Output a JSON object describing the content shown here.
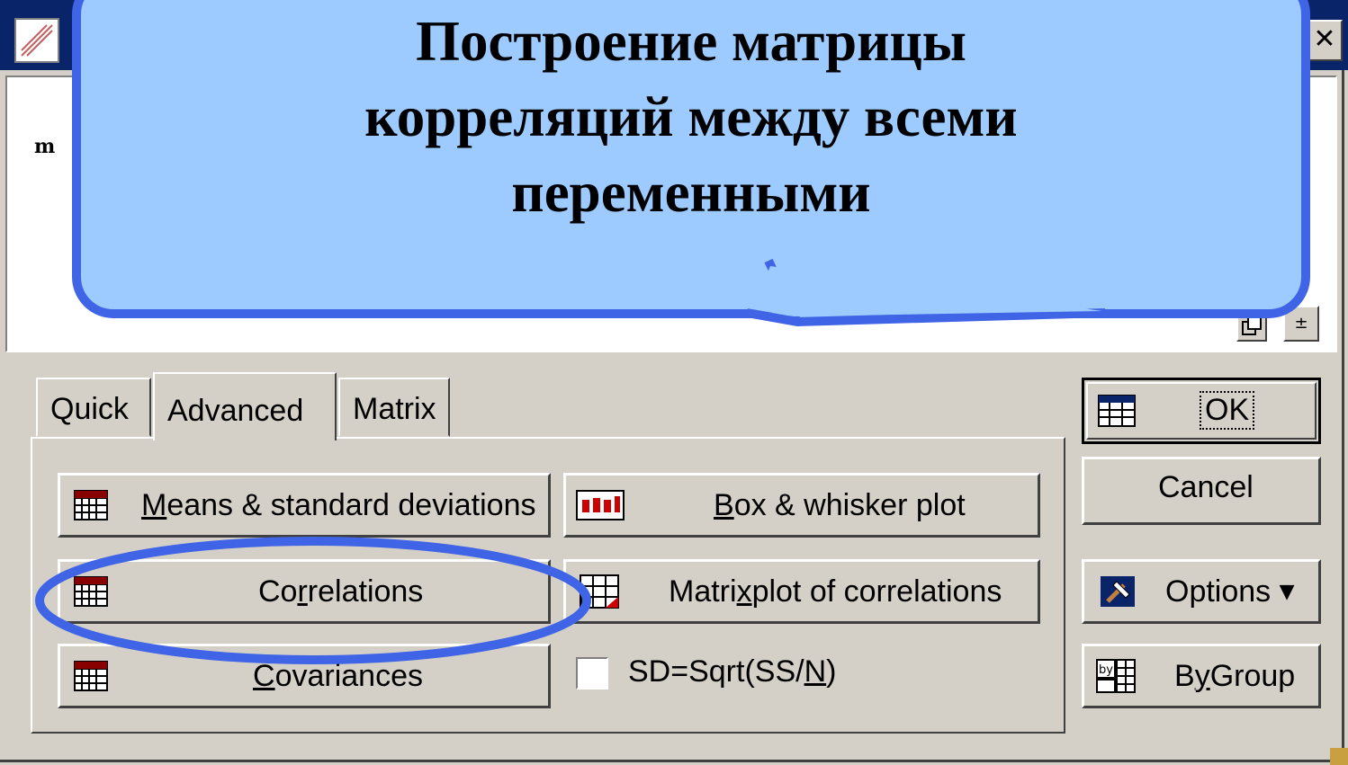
{
  "window": {
    "close_glyph": "✕",
    "results_text": "m"
  },
  "results_controls": {
    "copy_icon": "copy-icon",
    "collapse_glyph": "±"
  },
  "tabs": [
    {
      "label": "Quick",
      "active": false
    },
    {
      "label": "Advanced",
      "active": true
    },
    {
      "label": "Matrix",
      "active": false
    }
  ],
  "buttons": {
    "means_pre": "",
    "means_u": "M",
    "means_post": "eans & standard deviations",
    "box_pre": "",
    "box_u": "B",
    "box_post": "ox & whisker plot",
    "corr_pre": "Co",
    "corr_u": "r",
    "corr_post": "relations",
    "matrix_pre": "Matri",
    "matrix_u": "x",
    "matrix_post": " plot of correlations",
    "cov_pre": "",
    "cov_u": "C",
    "cov_post": "ovariances"
  },
  "checkbox": {
    "label_pre": "SD=Sqrt(SS/",
    "label_u": "N",
    "label_post": ")",
    "checked": false
  },
  "side_buttons": {
    "ok": "OK",
    "cancel": "Cancel",
    "options": "Options",
    "options_arrow": "▼",
    "by_group_pre": "B",
    "by_group_u": "y",
    "by_group_post": " Group"
  },
  "callout": {
    "lines": [
      "Построение матрицы",
      "корреляций между всеми",
      "переменными"
    ]
  },
  "colors": {
    "callout_fill": "#9dcbff",
    "callout_stroke": "#3f64e6",
    "dialog_bg": "#d4d0c8",
    "highlight_ellipse": "#3f64e6"
  }
}
